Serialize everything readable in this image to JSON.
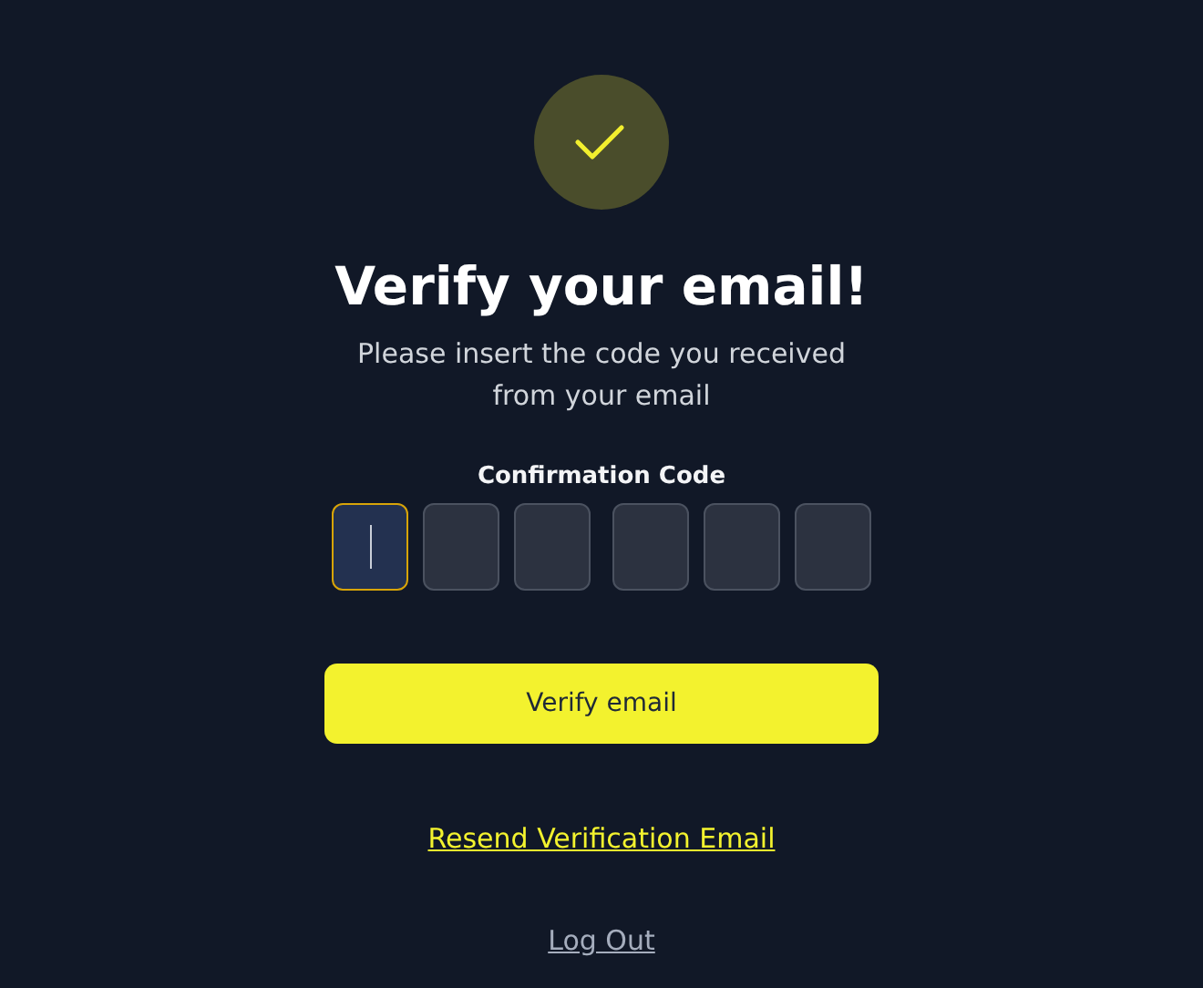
{
  "title": "Verify your email!",
  "subtitle": "Please insert the code you received from your email",
  "code_label": "Confirmation Code",
  "code_boxes": [
    {
      "focused": true
    },
    {
      "focused": false
    },
    {
      "focused": false
    },
    {
      "focused": false
    },
    {
      "focused": false
    },
    {
      "focused": false
    }
  ],
  "verify_button": "Verify email",
  "resend_link": "Resend Verification Email",
  "logout_link": "Log Out"
}
